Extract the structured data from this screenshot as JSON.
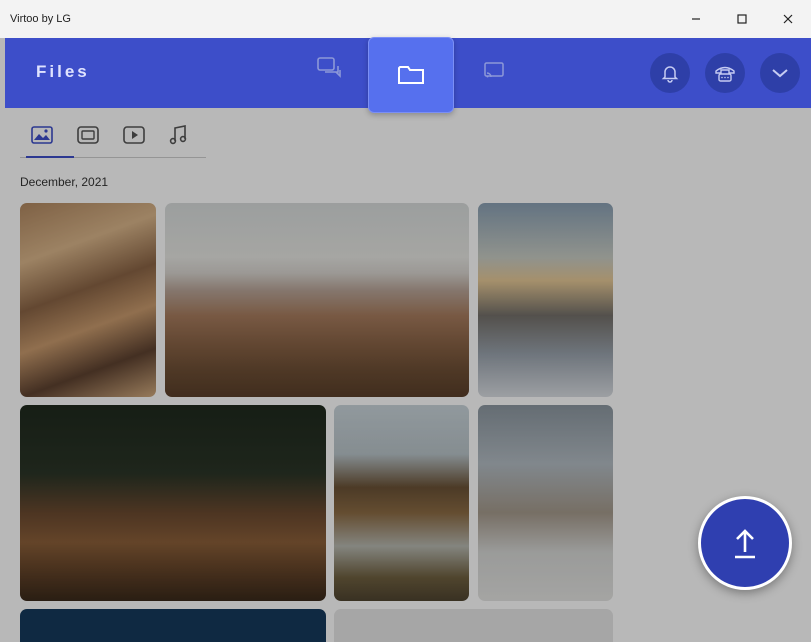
{
  "window": {
    "title": "Virtoo by LG"
  },
  "header": {
    "title": "Files"
  },
  "gallery": {
    "section_date": "December, 2021"
  },
  "colors": {
    "accent": "#3d4ec9",
    "header_dark": "#2e3fa8",
    "active_tab": "#5670ee"
  },
  "icons": {
    "nav": [
      "chat-icon",
      "folder-icon",
      "cast-icon"
    ],
    "header_buttons": [
      "bell-icon",
      "phone-icon",
      "chevron-down-icon"
    ],
    "subtabs": [
      "image-icon",
      "gallery-icon",
      "video-icon",
      "music-icon"
    ],
    "fab": "upload-arrow-icon"
  }
}
